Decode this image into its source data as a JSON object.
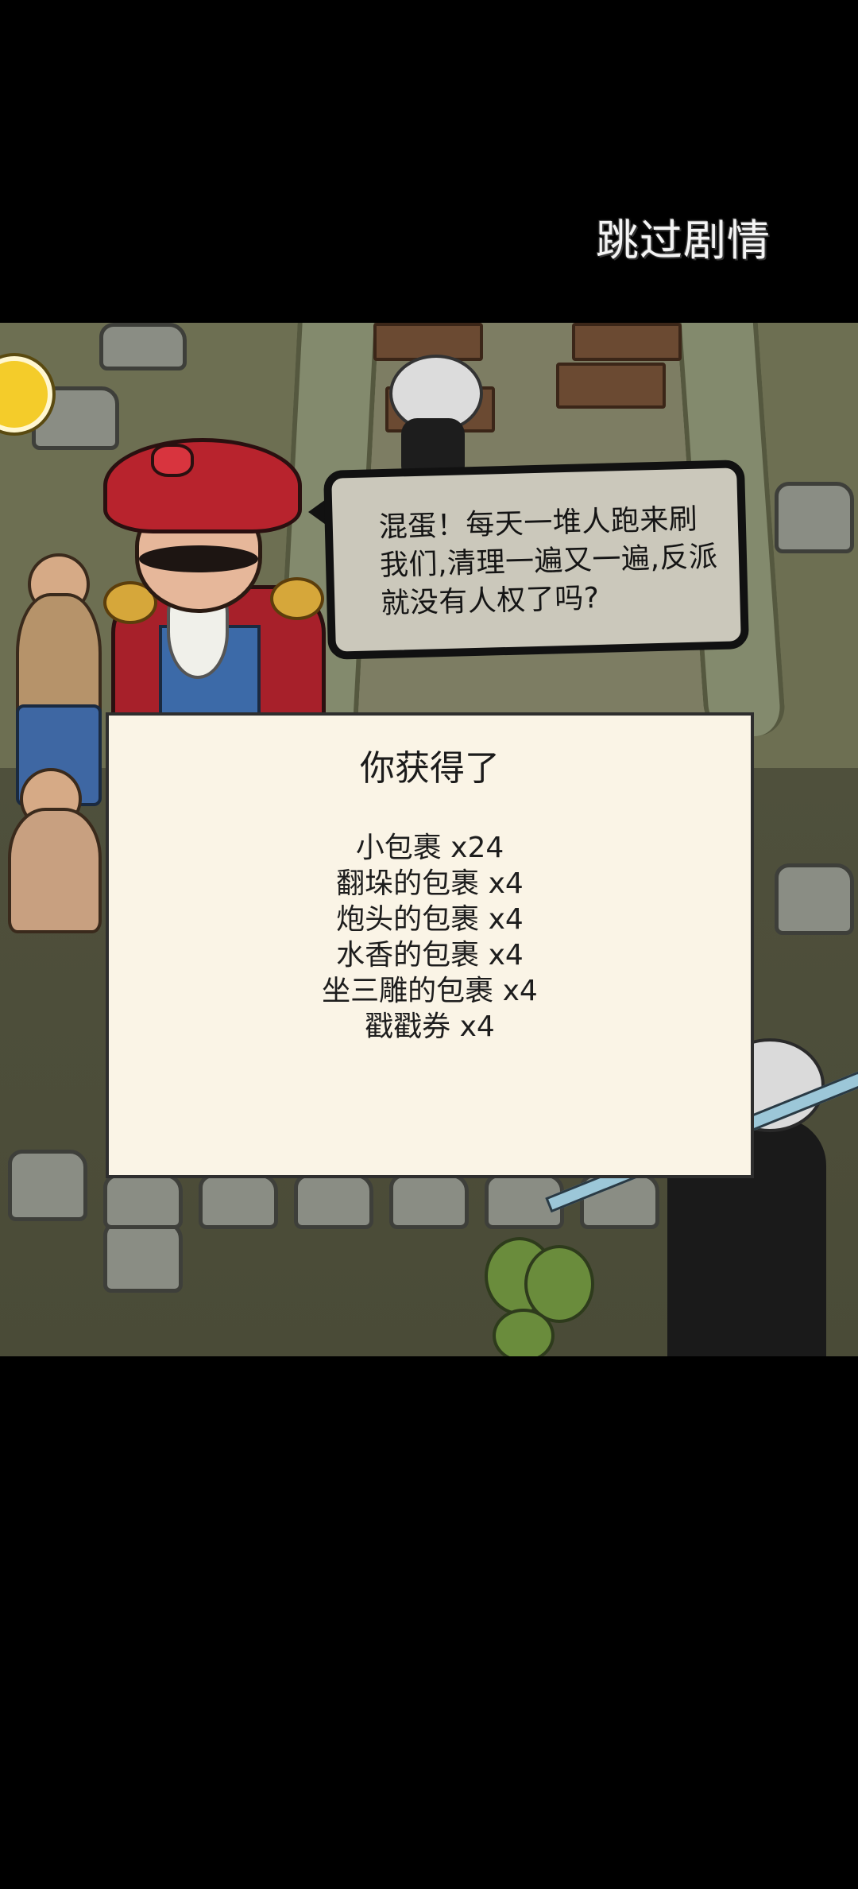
{
  "header": {
    "skip_label": "跳过剧情"
  },
  "dialogue": {
    "text": "混蛋！每天一堆人跑来刷我们,清理一遍又一遍,反派就没有人权了吗?"
  },
  "reward": {
    "title": "你获得了",
    "items": [
      {
        "text": "小包裹 x24"
      },
      {
        "text": "翻垛的包裹 x4"
      },
      {
        "text": "炮头的包裹 x4"
      },
      {
        "text": "水香的包裹 x4"
      },
      {
        "text": "坐三雕的包裹 x4"
      },
      {
        "text": "戳戳券 x4"
      }
    ]
  },
  "colors": {
    "panel_bg": "#faf4e6",
    "bubble_bg": "#cbc8bb",
    "scene_bg": "#6d6f52"
  }
}
